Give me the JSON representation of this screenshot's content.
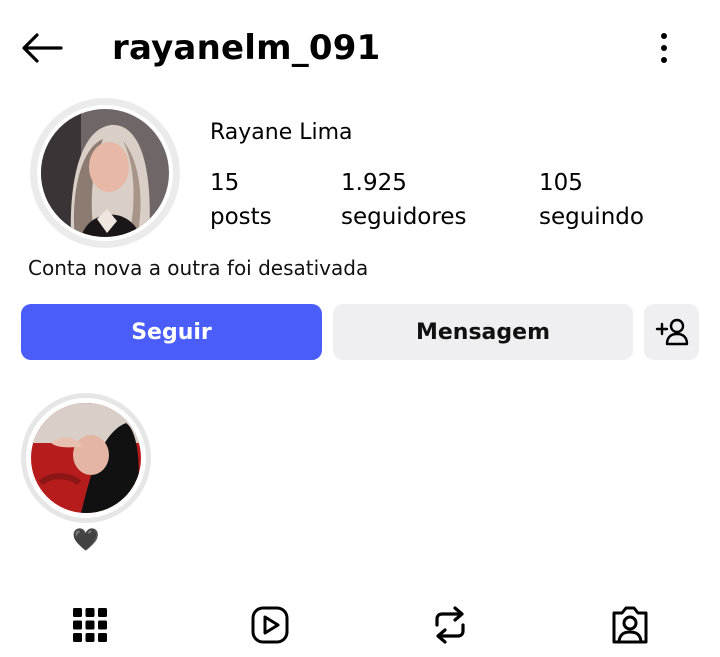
{
  "header": {
    "username": "rayanelm_091"
  },
  "profile": {
    "full_name": "Rayane Lima",
    "stats": [
      {
        "value": "15",
        "label": "posts"
      },
      {
        "value": "1.925",
        "label": "seguidores"
      },
      {
        "value": "105",
        "label": "seguindo"
      }
    ],
    "bio": "Conta nova a outra foi desativada"
  },
  "actions": {
    "follow_label": "Seguir",
    "message_label": "Mensagem"
  },
  "highlights": [
    {
      "label": "🖤"
    }
  ],
  "tabs": [
    {
      "icon": "grid-icon"
    },
    {
      "icon": "reels-icon"
    },
    {
      "icon": "reposts-icon"
    },
    {
      "icon": "tagged-icon"
    }
  ],
  "colors": {
    "follow_button": "#4a5df9",
    "secondary_button": "#efeff1"
  }
}
